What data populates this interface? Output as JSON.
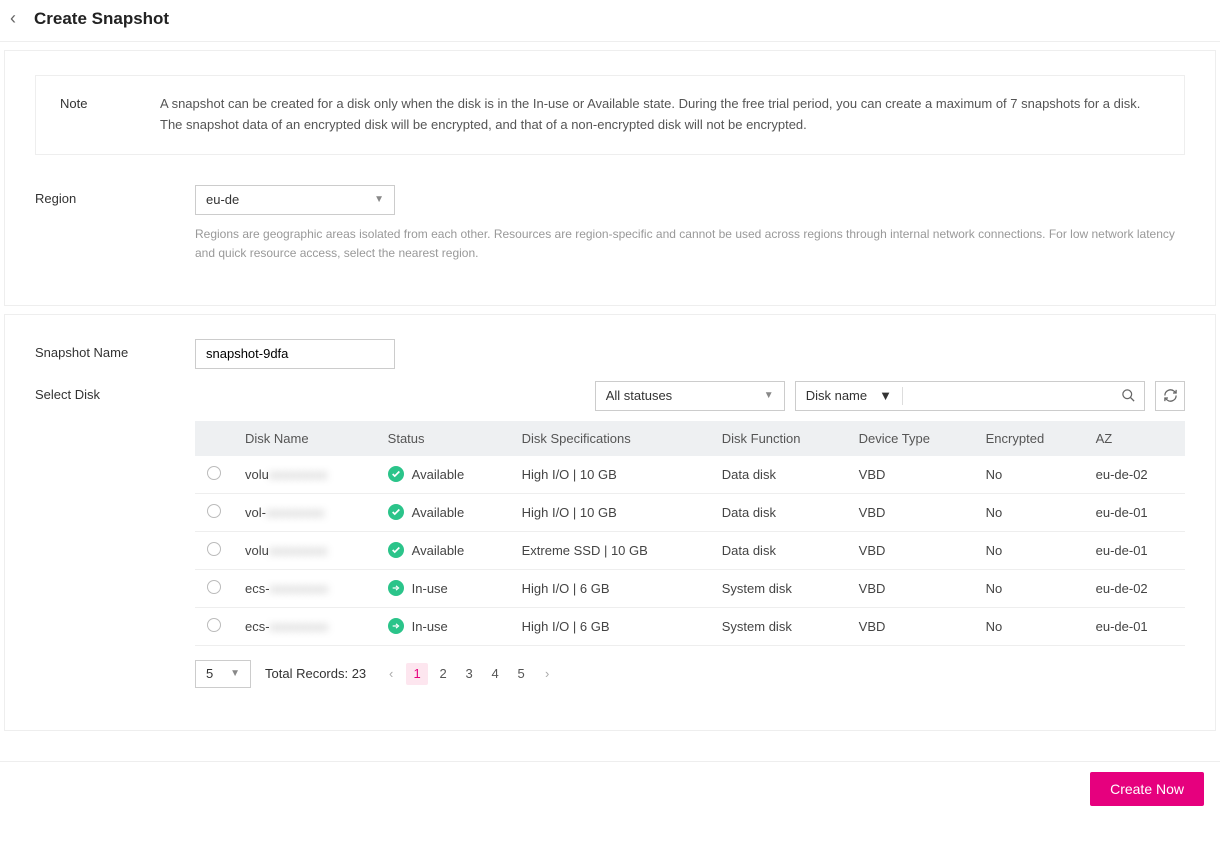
{
  "page": {
    "title": "Create Snapshot"
  },
  "note": {
    "label": "Note",
    "line1": "A snapshot can be created for a disk only when the disk is in the In-use or Available state. During the free trial period, you can create a maximum of 7 snapshots for a disk.",
    "line2": "The snapshot data of an encrypted disk will be encrypted, and that of a non-encrypted disk will not be encrypted."
  },
  "region": {
    "label": "Region",
    "value": "eu-de",
    "hint": "Regions are geographic areas isolated from each other. Resources are region-specific and cannot be used across regions through internal network connections. For low network latency and quick resource access, select the nearest region."
  },
  "snapshot": {
    "label": "Snapshot Name",
    "value": "snapshot-9dfa"
  },
  "selectDisk": {
    "label": "Select Disk",
    "statusFilter": "All statuses",
    "searchBy": "Disk name",
    "columns": {
      "name": "Disk Name",
      "status": "Status",
      "spec": "Disk Specifications",
      "function": "Disk Function",
      "device": "Device Type",
      "encrypted": "Encrypted",
      "az": "AZ"
    },
    "rows": [
      {
        "name": "volu",
        "blurredRest": "xxxxxxxxx",
        "status": "Available",
        "statusType": "available",
        "spec": "High I/O | 10 GB",
        "function": "Data disk",
        "device": "VBD",
        "encrypted": "No",
        "az": "eu-de-02"
      },
      {
        "name": "vol-",
        "blurredRest": "xxxxxxxxx",
        "status": "Available",
        "statusType": "available",
        "spec": "High I/O | 10 GB",
        "function": "Data disk",
        "device": "VBD",
        "encrypted": "No",
        "az": "eu-de-01"
      },
      {
        "name": "volu",
        "blurredRest": "xxxxxxxxx",
        "status": "Available",
        "statusType": "available",
        "spec": "Extreme SSD | 10 GB",
        "function": "Data disk",
        "device": "VBD",
        "encrypted": "No",
        "az": "eu-de-01"
      },
      {
        "name": "ecs-",
        "blurredRest": "xxxxxxxxx",
        "status": "In-use",
        "statusType": "inuse",
        "spec": "High I/O | 6 GB",
        "function": "System disk",
        "device": "VBD",
        "encrypted": "No",
        "az": "eu-de-02"
      },
      {
        "name": "ecs-",
        "blurredRest": "xxxxxxxxx",
        "status": "In-use",
        "statusType": "inuse",
        "spec": "High I/O | 6 GB",
        "function": "System disk",
        "device": "VBD",
        "encrypted": "No",
        "az": "eu-de-01"
      }
    ]
  },
  "pagination": {
    "pageSize": "5",
    "totalLabel": "Total Records: 23",
    "pages": [
      "1",
      "2",
      "3",
      "4",
      "5"
    ],
    "active": "1"
  },
  "footer": {
    "createLabel": "Create Now"
  }
}
